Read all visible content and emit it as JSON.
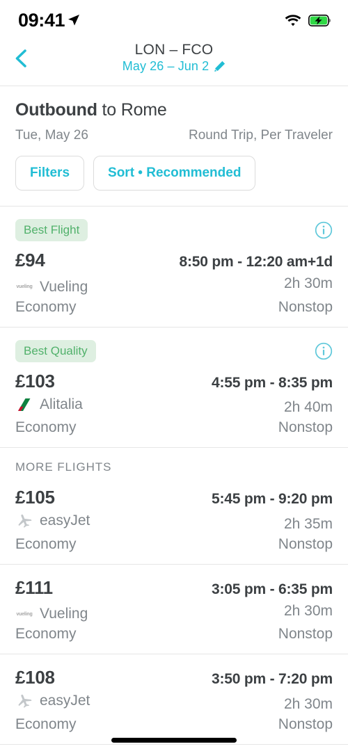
{
  "status_bar": {
    "time": "09:41",
    "location_icon": "location-arrow-icon",
    "wifi_icon": "wifi-icon",
    "battery_icon": "battery-charging-icon"
  },
  "header": {
    "back_icon": "chevron-left-icon",
    "route": "LON – FCO",
    "dates": "May 26 – Jun 2",
    "edit_icon": "pencil-icon"
  },
  "outbound": {
    "title_bold": "Outbound",
    "title_rest": " to Rome",
    "date": "Tue, May 26",
    "trip_type": "Round Trip, Per Traveler",
    "filters_label": "Filters",
    "sort_label": "Sort • Recommended"
  },
  "more_flights_label": "MORE FLIGHTS",
  "colors": {
    "accent": "#21bdd4",
    "badge_bg": "#deefe1",
    "badge_text": "#51b16b",
    "primary_text": "#3c4043",
    "secondary_text": "#80868b",
    "divider": "#e6e6e6"
  },
  "flights": [
    {
      "badge": "Best Flight",
      "info_icon": "info-circle-icon",
      "price": "£94",
      "times": "8:50 pm - 12:20 am+1d",
      "airline": "Vueling",
      "airline_logo": "vueling-logo",
      "duration": "2h 30m",
      "cabin": "Economy",
      "stops": "Nonstop"
    },
    {
      "badge": "Best Quality",
      "info_icon": "info-circle-icon",
      "price": "£103",
      "times": "4:55 pm - 8:35 pm",
      "airline": "Alitalia",
      "airline_logo": "alitalia-logo",
      "duration": "2h 40m",
      "cabin": "Economy",
      "stops": "Nonstop"
    },
    {
      "badge": null,
      "info_icon": null,
      "price": "£105",
      "times": "5:45 pm - 9:20 pm",
      "airline": "easyJet",
      "airline_logo": "airplane-icon",
      "duration": "2h 35m",
      "cabin": "Economy",
      "stops": "Nonstop"
    },
    {
      "badge": null,
      "info_icon": null,
      "price": "£111",
      "times": "3:05 pm - 6:35 pm",
      "airline": "Vueling",
      "airline_logo": "vueling-logo",
      "duration": "2h 30m",
      "cabin": "Economy",
      "stops": "Nonstop"
    },
    {
      "badge": null,
      "info_icon": null,
      "price": "£108",
      "times": "3:50 pm - 7:20 pm",
      "airline": "easyJet",
      "airline_logo": "airplane-icon",
      "duration": "2h 30m",
      "cabin": "Economy",
      "stops": "Nonstop"
    }
  ]
}
